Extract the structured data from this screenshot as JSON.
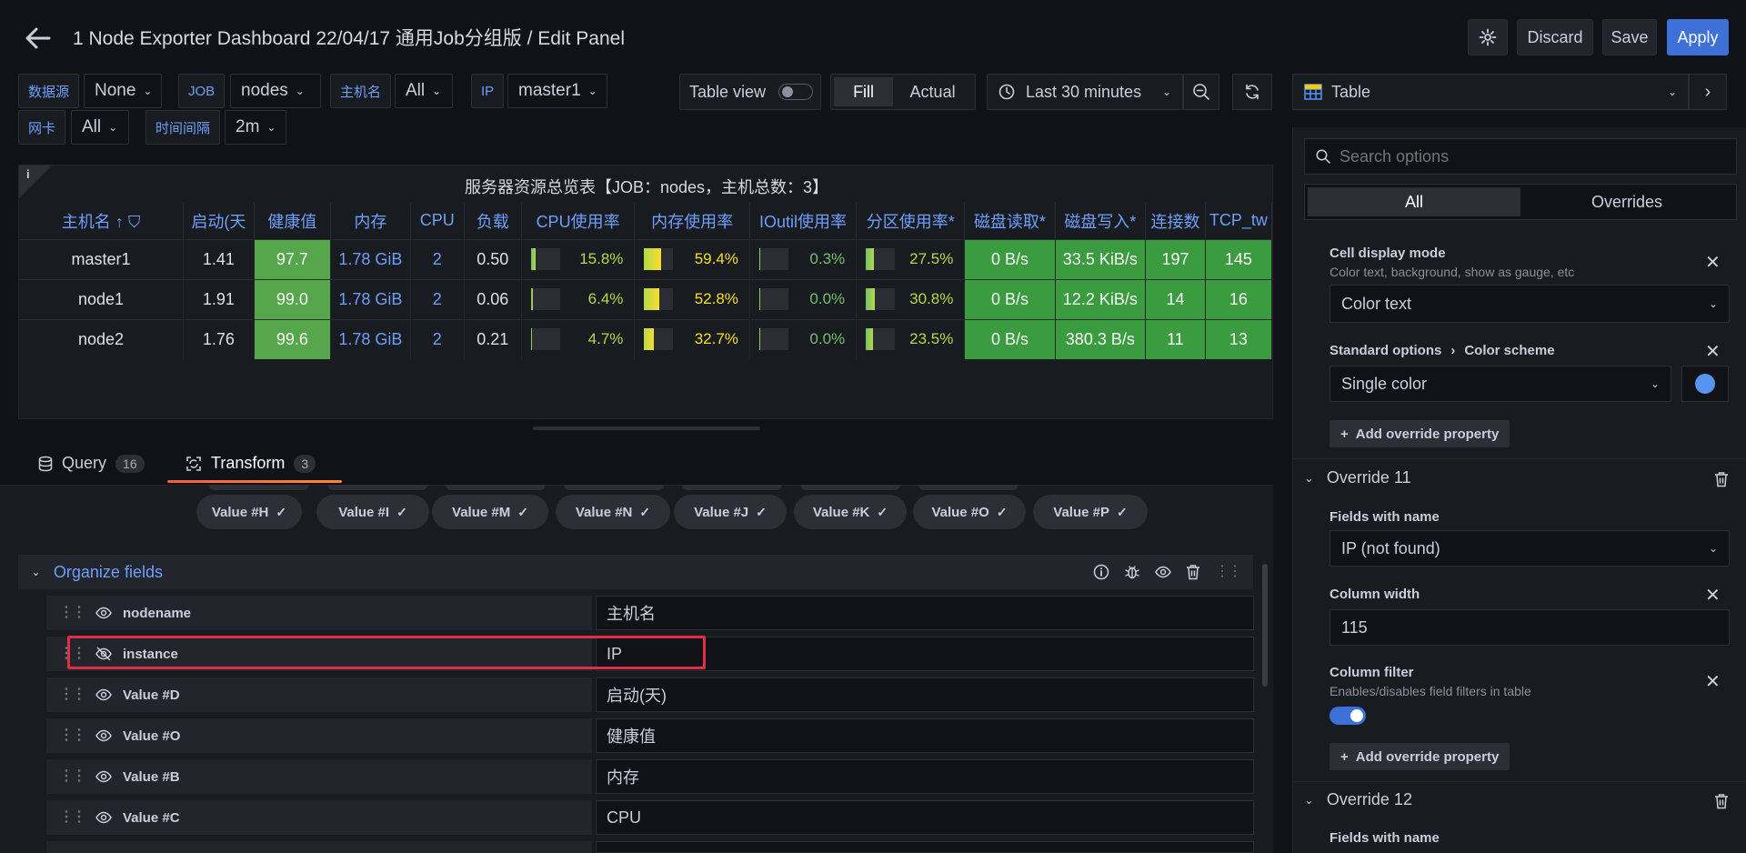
{
  "header": {
    "title": "1 Node Exporter Dashboard 22/04/17 通用Job分组版 / Edit Panel",
    "discard": "Discard",
    "save": "Save",
    "apply": "Apply"
  },
  "variables": [
    {
      "label": "数据源",
      "value": "None"
    },
    {
      "label": "JOB",
      "value": "nodes"
    },
    {
      "label": "主机名",
      "value": "All"
    },
    {
      "label": "IP",
      "value": "master1"
    },
    {
      "label": "网卡",
      "value": "All"
    },
    {
      "label": "时间间隔",
      "value": "2m"
    }
  ],
  "toolbar": {
    "table_view": "Table view",
    "fill": "Fill",
    "actual": "Actual",
    "time_range": "Last 30 minutes",
    "visualization": "Table"
  },
  "panel": {
    "info": "i",
    "title": "服务器资源总览表【JOB：nodes，主机总数：3】",
    "columns": [
      "主机名",
      "启动(天",
      "健康值",
      "内存",
      "CPU",
      "负载",
      "CPU使用率",
      "内存使用率",
      "IOutil使用率",
      "分区使用率*",
      "磁盘读取*",
      "磁盘写入*",
      "连接数",
      "TCP_tw"
    ],
    "rows": [
      {
        "host": "master1",
        "uptime": "1.41",
        "health": "97.7",
        "mem": "1.78 GiB",
        "cpu": "2",
        "load": "0.50",
        "cpu_use": "15.8%",
        "cpu_frac": 0.158,
        "mem_use": "59.4%",
        "mem_frac": 0.594,
        "io": "0.3%",
        "io_frac": 0.003,
        "part": "27.5%",
        "part_frac": 0.275,
        "read": "0 B/s",
        "write": "33.5 KiB/s",
        "conn": "197",
        "tcp": "145"
      },
      {
        "host": "node1",
        "uptime": "1.91",
        "health": "99.0",
        "mem": "1.78 GiB",
        "cpu": "2",
        "load": "0.06",
        "cpu_use": "6.4%",
        "cpu_frac": 0.064,
        "mem_use": "52.8%",
        "mem_frac": 0.528,
        "io": "0.0%",
        "io_frac": 0.0,
        "part": "30.8%",
        "part_frac": 0.308,
        "read": "0 B/s",
        "write": "12.2 KiB/s",
        "conn": "14",
        "tcp": "16"
      },
      {
        "host": "node2",
        "uptime": "1.76",
        "health": "99.6",
        "mem": "1.78 GiB",
        "cpu": "2",
        "load": "0.21",
        "cpu_use": "4.7%",
        "cpu_frac": 0.047,
        "mem_use": "32.7%",
        "mem_frac": 0.327,
        "io": "0.0%",
        "io_frac": 0.0,
        "part": "23.5%",
        "part_frac": 0.235,
        "read": "0 B/s",
        "write": "380.3 B/s",
        "conn": "11",
        "tcp": "13"
      }
    ]
  },
  "tabs": [
    {
      "label": "Query",
      "count": "16"
    },
    {
      "label": "Transform",
      "count": "3"
    }
  ],
  "chips": [
    "Value #H",
    "Value #I",
    "Value #M",
    "Value #N",
    "Value #J",
    "Value #K",
    "Value #O",
    "Value #P"
  ],
  "organize": {
    "title": "Organize fields",
    "rows": [
      {
        "field": "nodename",
        "rename": "主机名",
        "hidden": false
      },
      {
        "field": "instance",
        "rename": "IP",
        "hidden": true
      },
      {
        "field": "Value #D",
        "rename": "启动(天)",
        "hidden": false
      },
      {
        "field": "Value #O",
        "rename": "健康值",
        "hidden": false
      },
      {
        "field": "Value #B",
        "rename": "内存",
        "hidden": false
      },
      {
        "field": "Value #C",
        "rename": "CPU",
        "hidden": false
      }
    ]
  },
  "options": {
    "search_placeholder": "Search options",
    "tab_all": "All",
    "tab_overrides": "Overrides",
    "cell_display_title": "Cell display mode",
    "cell_display_sub": "Color text, background, show as gauge, etc",
    "cell_display_value": "Color text",
    "color_scheme_crumb1": "Standard options",
    "color_scheme_crumb2": "Color scheme",
    "color_scheme_value": "Single color",
    "color_swatch": "#5794f2",
    "add_override": "Add override property",
    "override11": "Override 11",
    "fields_with_name": "Fields with name",
    "fields_value": "IP (not found)",
    "column_width": "Column width",
    "column_width_value": "115",
    "column_filter": "Column filter",
    "column_filter_sub": "Enables/disables field filters in table",
    "override12": "Override 12",
    "fields_with_name2": "Fields with name"
  },
  "colors": {
    "accent": "#3d71d9",
    "link": "#6e9fff",
    "green": "#3b9b3f",
    "highlight": "#e02f44",
    "tab_underline": "#f55f3e"
  }
}
